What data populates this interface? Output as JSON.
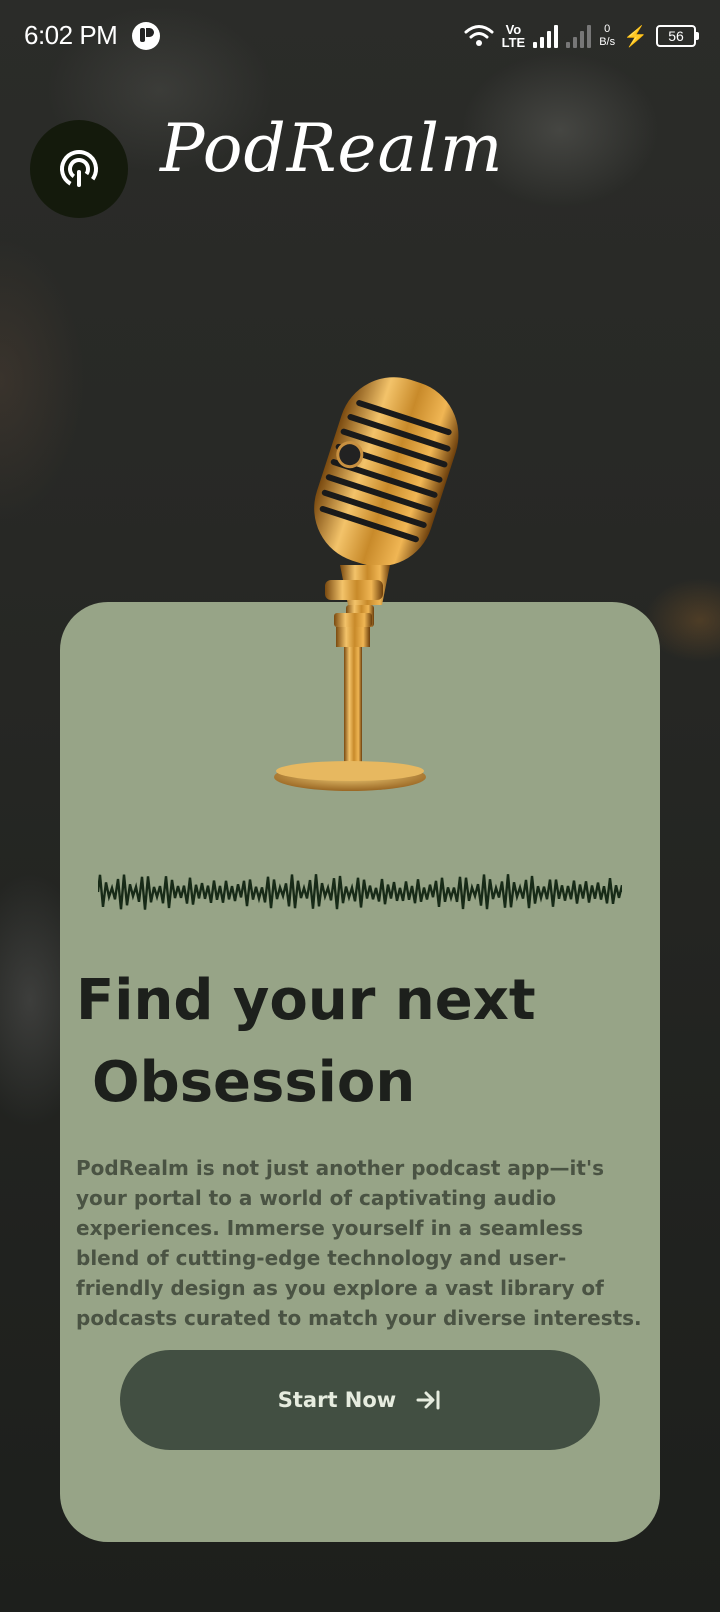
{
  "status_bar": {
    "time": "6:02 PM",
    "volte_top": "Vo",
    "volte_bottom": "LTE",
    "net_speed_value": "0",
    "net_speed_unit": "B/s",
    "battery": "56"
  },
  "app": {
    "name": "PodRealm",
    "logo_icon": "podcast-icon"
  },
  "hero": {
    "image": "golden-microphone",
    "waveform": "audio-waveform"
  },
  "headline": {
    "line1": "Find your next",
    "line2": "Obsession"
  },
  "description": "PodRealm is not just another podcast app—it's your portal to a world of captivating audio experiences. Immerse yourself in a seamless blend of cutting-edge technology and user-friendly design as you explore a vast library of podcasts curated to match your diverse interests.",
  "cta": {
    "label": "Start Now",
    "icon": "arrow-right-to-line-icon"
  },
  "colors": {
    "card": "#97a487",
    "button": "#424f42",
    "logo_circle": "#141a0c",
    "headline": "#1d201c"
  }
}
